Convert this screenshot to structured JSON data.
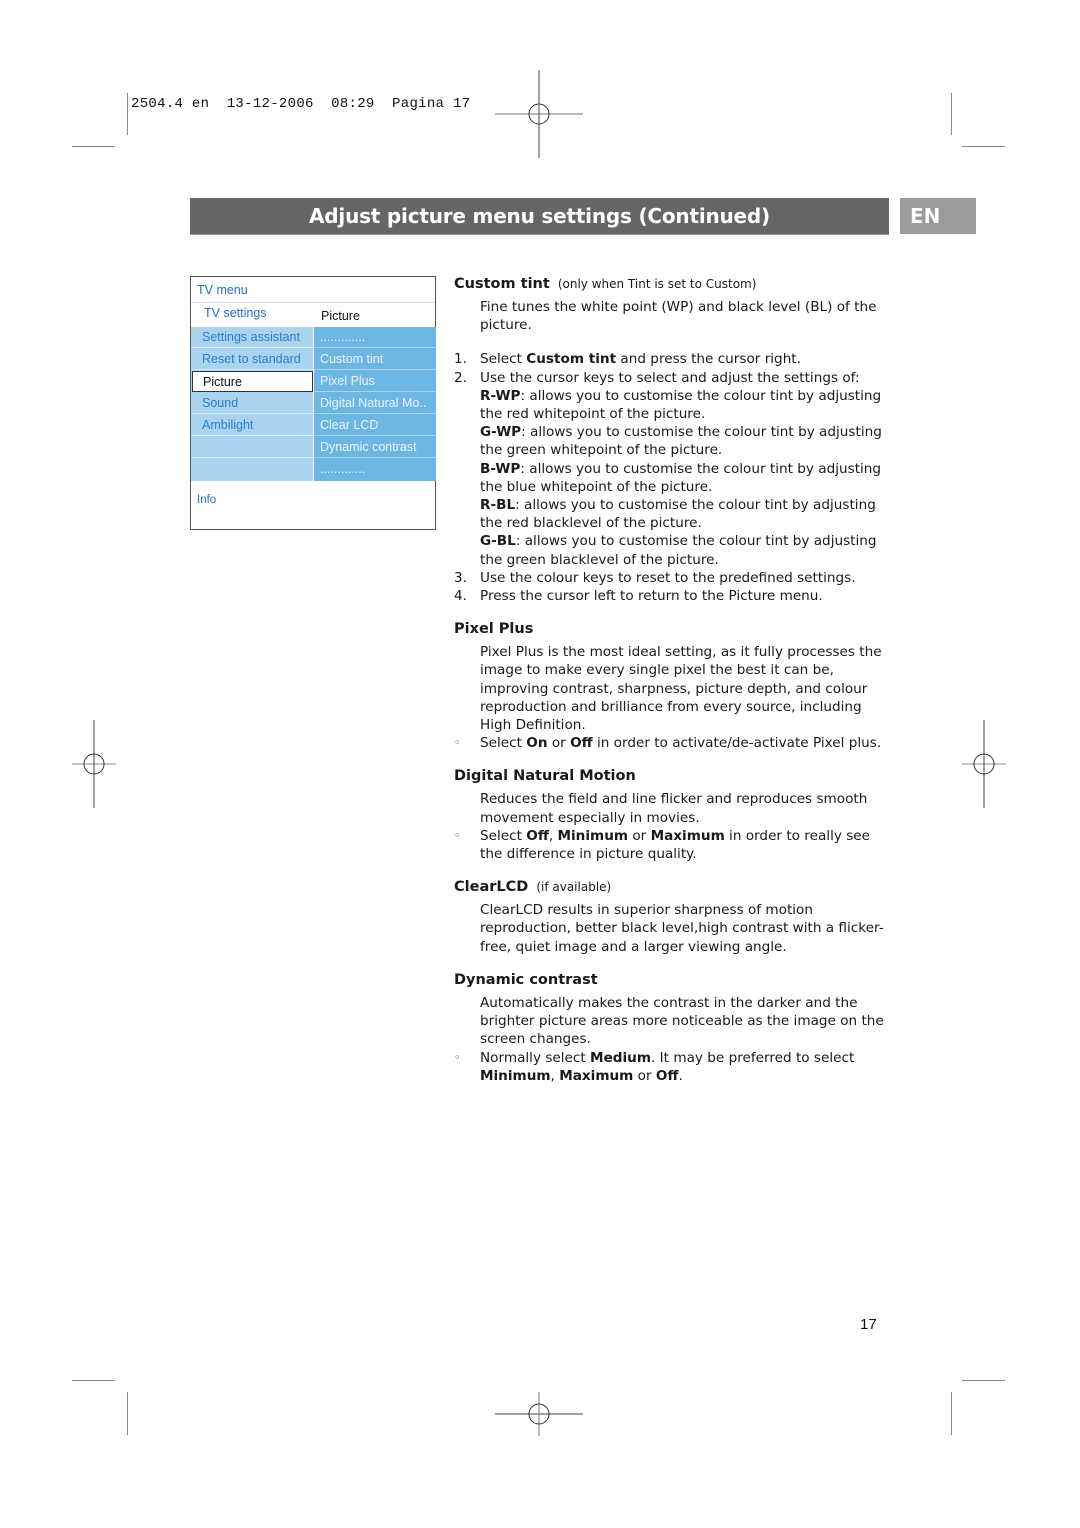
{
  "slug": {
    "text": "2504.4 en  13-12-2006  08:29  Pagina 17"
  },
  "header": {
    "title": "Adjust picture menu settings  (Continued)",
    "language_tab": "EN"
  },
  "tv_menu": {
    "title": "TV menu",
    "subtitle": "TV settings",
    "breadcrumb": "Picture",
    "left_items": [
      {
        "label": "Settings assistant",
        "selected": false
      },
      {
        "label": "Reset to standard",
        "selected": false
      },
      {
        "label": "Picture",
        "selected": true
      },
      {
        "label": "Sound",
        "selected": false
      },
      {
        "label": "Ambilight",
        "selected": false
      },
      {
        "label": "",
        "selected": false
      },
      {
        "label": "",
        "selected": false
      }
    ],
    "right_items": [
      {
        "label": "............."
      },
      {
        "label": "Custom tint"
      },
      {
        "label": "Pixel Plus"
      },
      {
        "label": "Digital Natural Mo.."
      },
      {
        "label": "Clear LCD"
      },
      {
        "label": "Dynamic contrast"
      },
      {
        "label": "............."
      }
    ],
    "info_label": "Info"
  },
  "sections": {
    "custom_tint": {
      "heading": "Custom tint",
      "note": "(only when Tint is set to Custom)",
      "intro": "Fine tunes the white point (WP) and black level (BL) of the picture.",
      "steps": [
        {
          "num": "1.",
          "pre": "Select ",
          "bold": "Custom tint",
          "post": " and press the cursor right."
        },
        {
          "num": "2.",
          "text": "Use the cursor keys to select and adjust the settings of:"
        }
      ],
      "settings": [
        {
          "key": "R-WP",
          "desc": ": allows you to customise the colour tint by adjusting the red whitepoint of the picture."
        },
        {
          "key": "G-WP",
          "desc": ": allows you to customise the colour tint by adjusting the green whitepoint of the picture."
        },
        {
          "key": "B-WP",
          "desc": ": allows you to customise the colour tint by adjusting the blue whitepoint of the picture."
        },
        {
          "key": "R-BL",
          "desc": ": allows you to customise the colour tint by adjusting the red blacklevel of the picture."
        },
        {
          "key": "G-BL",
          "desc": ": allows you to customise the colour tint by adjusting the green blacklevel of the picture."
        }
      ],
      "steps_after": [
        {
          "num": "3.",
          "text": "Use the colour keys to reset to the predefined settings."
        },
        {
          "num": "4.",
          "text": "Press the cursor left to return to the Picture menu."
        }
      ]
    },
    "pixel_plus": {
      "heading": "Pixel Plus",
      "body": "Pixel Plus is the most ideal setting, as it fully processes the image to make every single pixel the best it can be, improving contrast, sharpness, picture depth, and colour reproduction and brilliance from every source, including High Definition.",
      "bullet": {
        "t1": "Select ",
        "b1": "On",
        "t2": " or ",
        "b2": "Off",
        "t3": " in order to activate/de-activate Pixel plus."
      }
    },
    "dnm": {
      "heading": "Digital Natural Motion",
      "body": "Reduces the field and line flicker and reproduces smooth movement especially in movies.",
      "bullet": {
        "t1": "Select ",
        "b1": "Off",
        "t2": ", ",
        "b2": "Minimum",
        "t3": " or ",
        "b3": "Maximum",
        "t4": " in order to really see the difference in picture quality."
      }
    },
    "clearlcd": {
      "heading": "ClearLCD",
      "note": "(if available)",
      "body": "ClearLCD results in superior sharpness of motion reproduction, better black level,high contrast with a flicker-free, quiet image and a larger viewing angle."
    },
    "dynamic_contrast": {
      "heading": "Dynamic contrast",
      "body": "Automatically makes the contrast in the darker and the brighter picture areas more noticeable as the image on the screen changes.",
      "bullet": {
        "t1": "Normally select ",
        "b1": "Medium",
        "t2": ". It may be preferred to select ",
        "b2": "Minimum",
        "t3": ", ",
        "b3": "Maximum",
        "t4": " or ",
        "b4": "Off",
        "t5": "."
      }
    }
  },
  "bullet_glyph": "◦",
  "page_number": "17",
  "colors": {
    "title_bar": "#656565",
    "lang_tab": "#9b9b9b",
    "menu_left": "#a9d3ef",
    "menu_right": "#6cb6e3",
    "menu_text": "#2a6cc7"
  }
}
